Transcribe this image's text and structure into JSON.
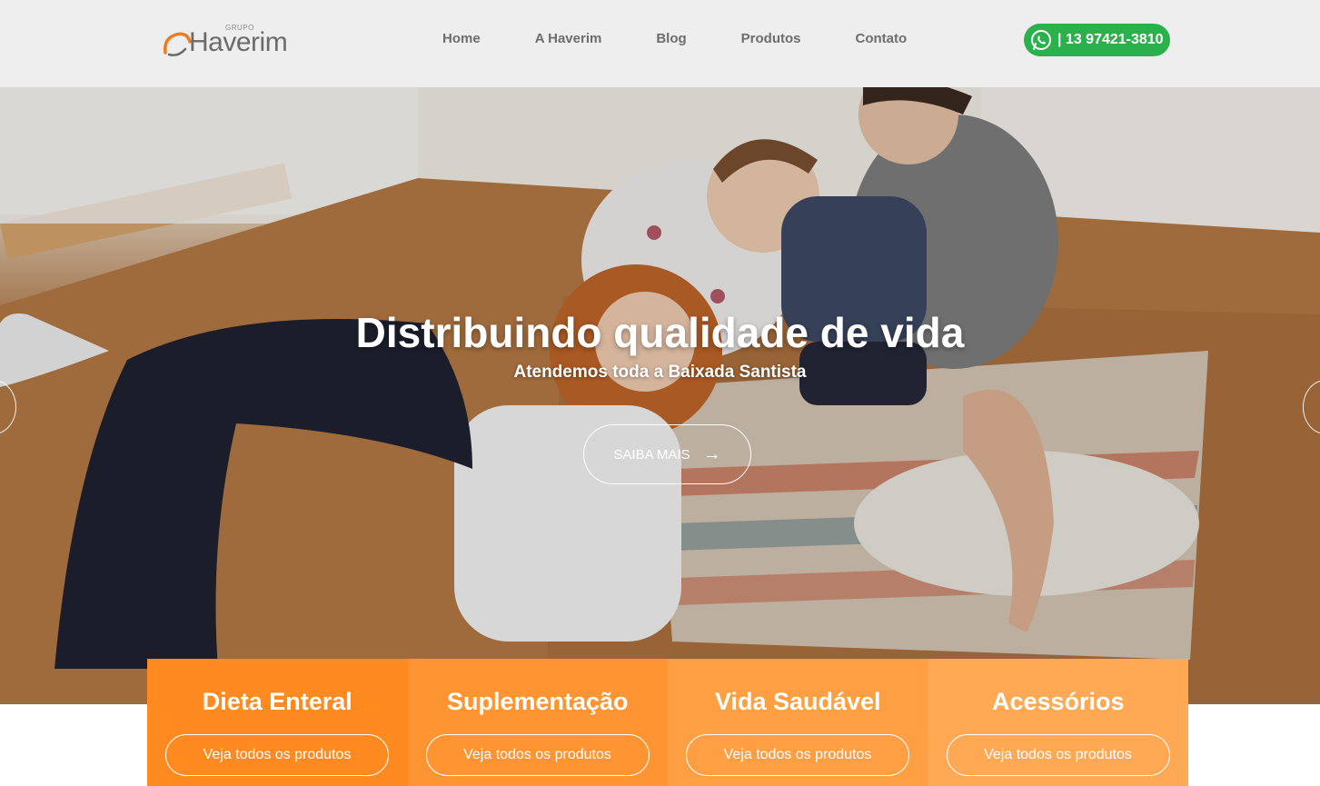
{
  "header": {
    "logo_small": "GRUPO",
    "logo_text": "Haverim",
    "nav": [
      "Home",
      "A Haverim",
      "Blog",
      "Produtos",
      "Contato"
    ],
    "whatsapp_label": "| 13 97421-3810",
    "whatsapp_icon": "whatsapp-icon"
  },
  "hero": {
    "title": "Distribuindo qualidade de vida",
    "subtitle": "Atendemos toda a Baixada Santista",
    "button_label": "SAIBA MAIS",
    "button_icon": "→"
  },
  "categories": [
    {
      "title": "Dieta Enteral",
      "button": "Veja todos os produtos",
      "color": "#ff8a1f"
    },
    {
      "title": "Suplementação",
      "button": "Veja todos os produtos",
      "color": "#ff9432"
    },
    {
      "title": "Vida Saudável",
      "button": "Veja todos os produtos",
      "color": "#ff9f44"
    },
    {
      "title": "Acessórios",
      "button": "Veja todos os produtos",
      "color": "#ffa955"
    }
  ]
}
